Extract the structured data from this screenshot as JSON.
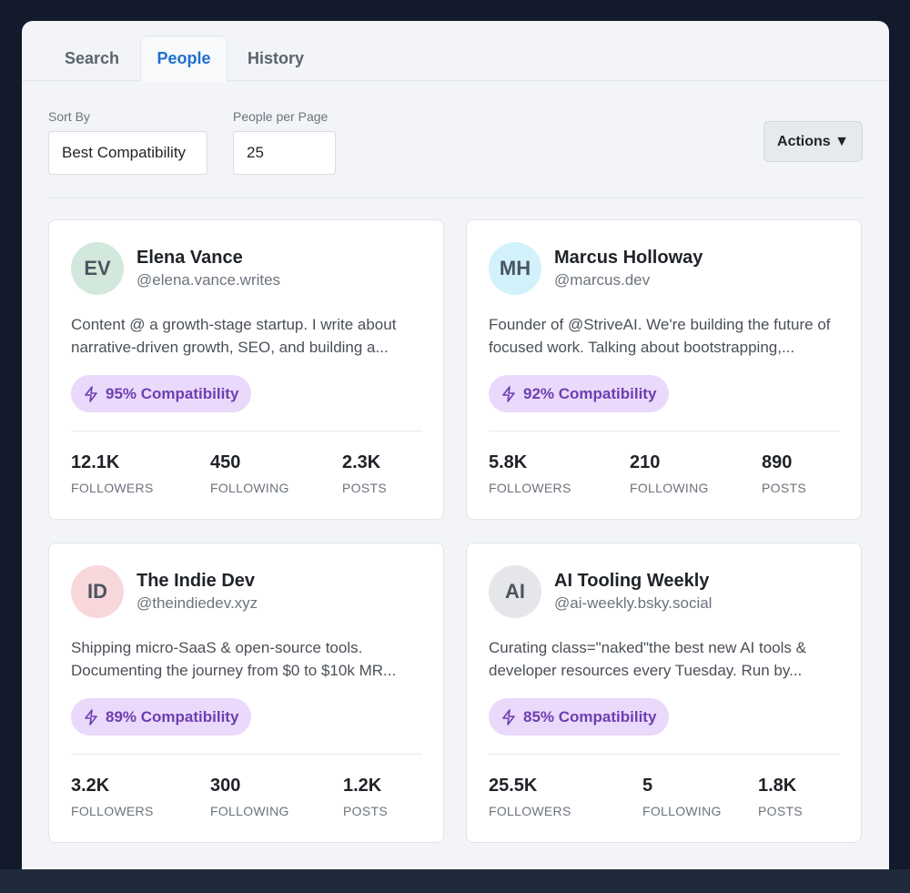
{
  "tabs": [
    {
      "label": "Search",
      "active": false
    },
    {
      "label": "People",
      "active": true
    },
    {
      "label": "History",
      "active": false
    }
  ],
  "controls": {
    "sort_label": "Sort By",
    "sort_value": "Best Compatibility",
    "per_page_label": "People per Page",
    "per_page_value": "25",
    "actions_label": "Actions ▼"
  },
  "stat_labels": {
    "followers": "FOLLOWERS",
    "following": "FOLLOWING",
    "posts": "POSTS"
  },
  "people": [
    {
      "initials": "EV",
      "avatar_color": "#d3e8dc",
      "name": "Elena Vance",
      "handle": "@elena.vance.writes",
      "bio": "Content @ a growth-stage startup. I write about narrative-driven growth, SEO, and building a...",
      "compatibility": "95% Compatibility",
      "followers": "12.1K",
      "following": "450",
      "posts": "2.3K"
    },
    {
      "initials": "MH",
      "avatar_color": "#d2f1fb",
      "name": "Marcus Holloway",
      "handle": "@marcus.dev",
      "bio": "Founder of @StriveAI. We're building the future of focused work. Talking about bootstrapping,...",
      "compatibility": "92% Compatibility",
      "followers": "5.8K",
      "following": "210",
      "posts": "890"
    },
    {
      "initials": "ID",
      "avatar_color": "#f8d7da",
      "name": "The Indie Dev",
      "handle": "@theindiedev.xyz",
      "bio": "Shipping micro-SaaS & open-source tools. Documenting the journey from $0 to $10k MR...",
      "compatibility": "89% Compatibility",
      "followers": "3.2K",
      "following": "300",
      "posts": "1.2K"
    },
    {
      "initials": "AI",
      "avatar_color": "#e4e6e9",
      "name": "AI Tooling Weekly",
      "handle": "@ai-weekly.bsky.social",
      "bio": "Curating class=\"naked\"the best new AI tools & developer resources every Tuesday. Run by...",
      "compatibility": "85% Compatibility",
      "followers": "25.5K",
      "following": "5",
      "posts": "1.8K"
    }
  ],
  "colors": {
    "accent": "#1e6fd0",
    "badge_bg": "#ead9fb",
    "badge_text": "#6d3fb0"
  }
}
